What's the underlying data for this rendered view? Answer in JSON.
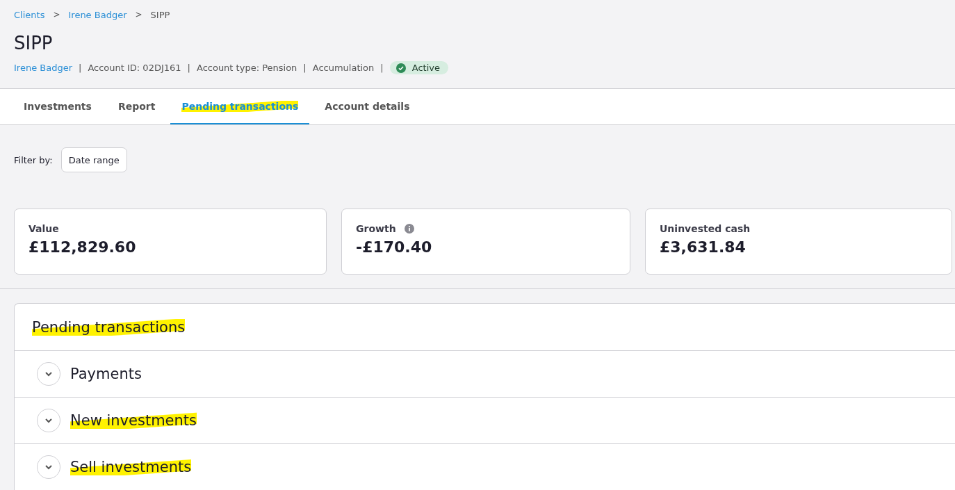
{
  "breadcrumb": [
    {
      "label": "Clients",
      "link": true
    },
    {
      "label": "Irene Badger",
      "link": true
    },
    {
      "label": "SIPP",
      "link": false
    }
  ],
  "breadcrumb_separator": ">",
  "title": "SIPP",
  "meta": [
    {
      "text": "Irene Badger",
      "link": true
    },
    {
      "text": "Account ID: 02DJ161",
      "link": false
    },
    {
      "text": "Account type: Pension",
      "link": false
    },
    {
      "text": "Accumulation",
      "link": false
    }
  ],
  "meta_separator": "|",
  "status_badge": {
    "label": "Active"
  },
  "tabs": [
    {
      "label": "Investments",
      "selected": false,
      "highlighted": false
    },
    {
      "label": "Report",
      "selected": false,
      "highlighted": false
    },
    {
      "label": "Pending transactions",
      "selected": true,
      "highlighted": true
    },
    {
      "label": "Account details",
      "selected": false,
      "highlighted": false
    }
  ],
  "filter": {
    "label": "Filter by:",
    "button": "Date range"
  },
  "summary_cards": [
    {
      "label": "Value",
      "value": "£112,829.60",
      "info": false
    },
    {
      "label": "Growth",
      "value": "-£170.40",
      "info": true
    },
    {
      "label": "Uninvested cash",
      "value": "£3,631.84",
      "info": false
    }
  ],
  "panel": {
    "title": "Pending transactions",
    "highlighted": true,
    "sections": [
      {
        "label": "Payments",
        "expanded": false,
        "highlighted": false
      },
      {
        "label": "New investments",
        "expanded": false,
        "highlighted": true
      },
      {
        "label": "Sell investments",
        "expanded": false,
        "highlighted": true
      }
    ]
  }
}
